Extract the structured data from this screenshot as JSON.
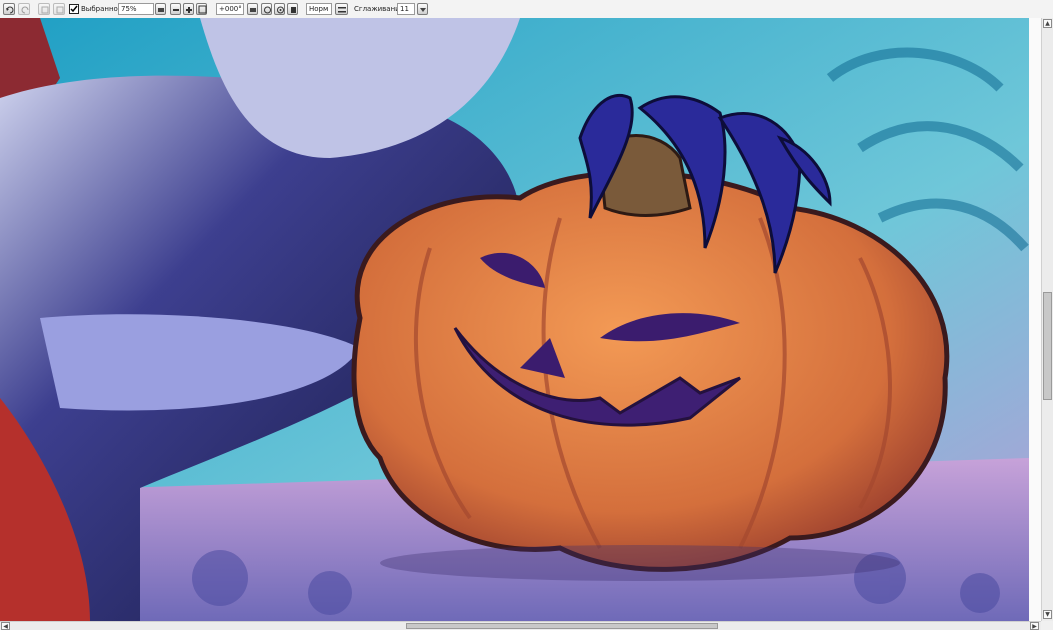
{
  "toolbar": {
    "icons": [
      "undo-icon",
      "redo-icon",
      "layer-icon",
      "layer-icon",
      "flip-icon",
      "zoom-out-icon",
      "zoom-fit-icon",
      "zoom-in-icon",
      "rotate-left-icon",
      "rotate-reset-icon",
      "rotate-right-icon",
      "view-mode-icon"
    ],
    "checkbox_label": "Выбранное",
    "checkbox_checked": true,
    "zoom_value": "75%",
    "rotation_value": "+000°",
    "blend_mode": "Норм",
    "smoothing_label": "Сглаживание",
    "smoothing_value": "11"
  },
  "canvas": {
    "content": "artwork",
    "colors": {
      "sky": "#3fa9c8",
      "pumpkin": "#e07a3c",
      "cloth": "#2b2e7a",
      "stone": "#9a8fd0",
      "red": "#c23a3a"
    }
  },
  "scrollbars": {
    "vertical_position": 0.45,
    "horizontal_position": 0.39
  }
}
